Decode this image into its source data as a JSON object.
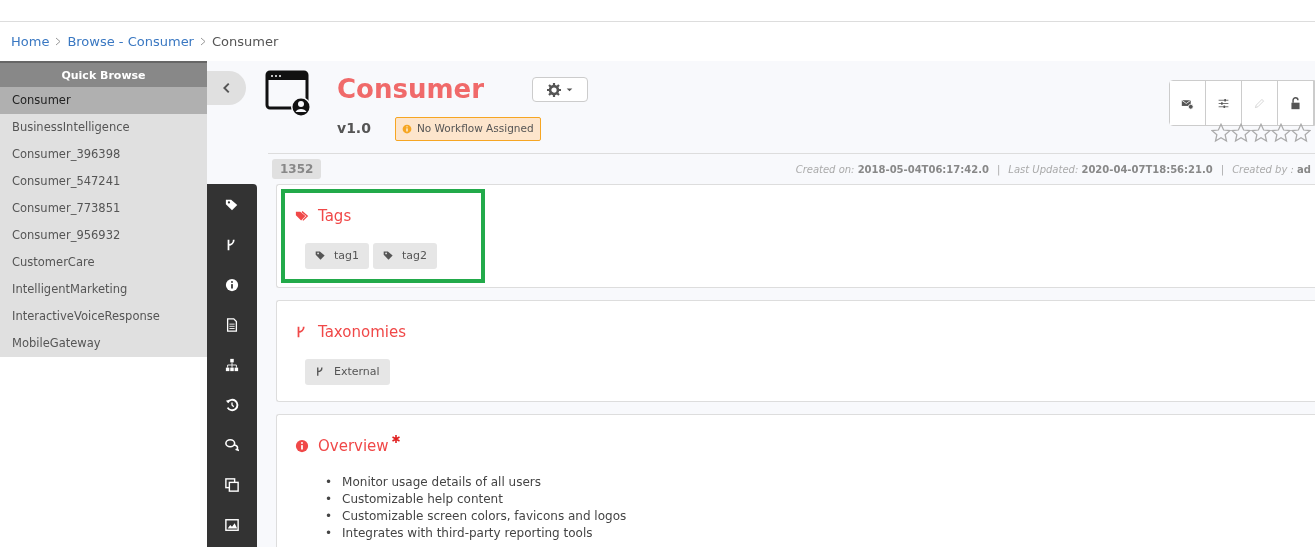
{
  "breadcrumb": [
    {
      "label": "Home",
      "link": true
    },
    {
      "label": "Browse - Consumer",
      "link": true
    },
    {
      "label": "Consumer",
      "link": false
    }
  ],
  "quick_browse": {
    "title": "Quick Browse",
    "items": [
      {
        "label": "Consumer",
        "selected": true
      },
      {
        "label": "BusinessIntelligence",
        "selected": false
      },
      {
        "label": "Consumer_396398",
        "selected": false
      },
      {
        "label": "Consumer_547241",
        "selected": false
      },
      {
        "label": "Consumer_773851",
        "selected": false
      },
      {
        "label": "Consumer_956932",
        "selected": false
      },
      {
        "label": "CustomerCare",
        "selected": false
      },
      {
        "label": "IntelligentMarketing",
        "selected": false
      },
      {
        "label": "InteractiveVoiceResponse",
        "selected": false
      },
      {
        "label": "MobileGateway",
        "selected": false
      }
    ]
  },
  "header": {
    "title": "Consumer",
    "version": "v1.0",
    "workflow_badge": "No Workflow Assigned",
    "id_badge": "1352",
    "stars": 0,
    "meta": [
      {
        "label": "Created on:",
        "value": "2018-05-04T06:17:42.0"
      },
      {
        "separator": "|",
        "label": "Last Updated:",
        "value": "2020-04-07T18:56:21.0"
      },
      {
        "separator": "|",
        "label": "Created by :",
        "value": "ad"
      }
    ],
    "toolbar": [
      {
        "kind": "mail",
        "disabled": false
      },
      {
        "kind": "sliders",
        "disabled": false
      },
      {
        "kind": "pencil",
        "disabled": true
      },
      {
        "kind": "lock",
        "disabled": false
      }
    ]
  },
  "sections": [
    {
      "kind": "tags",
      "title": "Tags",
      "highlighted": true,
      "chips": [
        "tag1",
        "tag2"
      ]
    },
    {
      "kind": "taxonomies",
      "title": "Taxonomies",
      "highlighted": false,
      "chips": [
        "External"
      ]
    },
    {
      "kind": "overview",
      "title": "Overview",
      "highlighted": false,
      "required": true,
      "bullets": [
        {
          "marker": "•",
          "text": "Monitor usage details of all users"
        },
        {
          "marker": "•",
          "text": "Customizable help content"
        },
        {
          "marker": "•",
          "text": "Customizable screen colors, favicons and logos"
        },
        {
          "marker": "•",
          "text": "Integrates with third-party reporting tools"
        }
      ]
    }
  ]
}
